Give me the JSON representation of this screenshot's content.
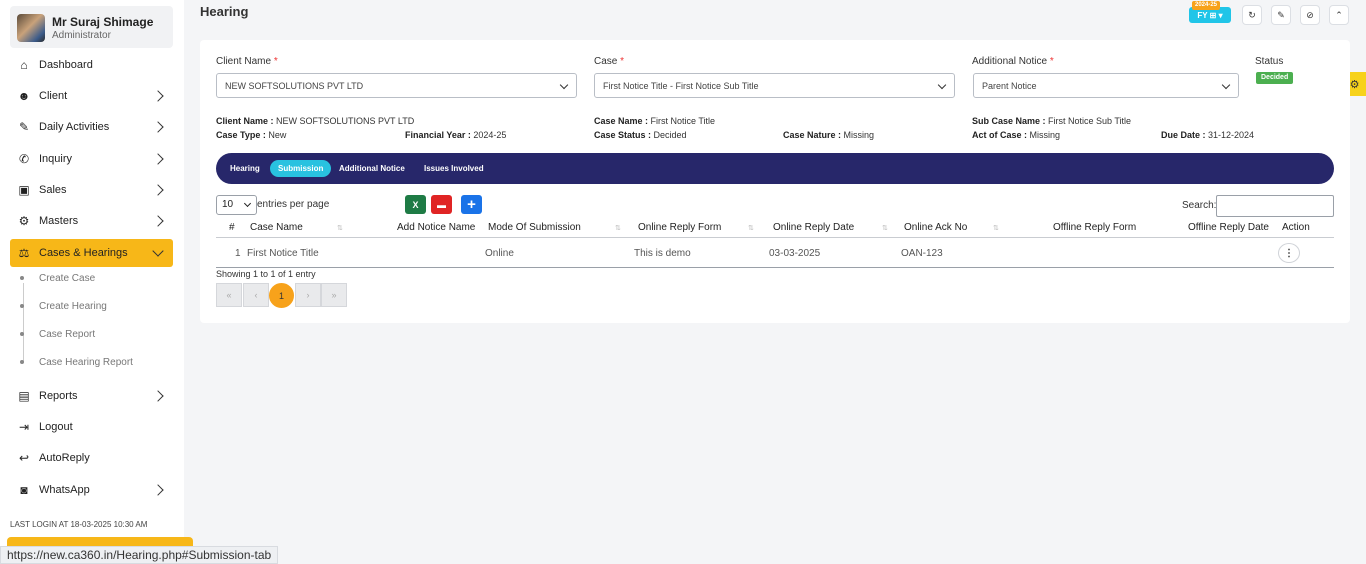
{
  "user": {
    "name": "Mr Suraj Shimage",
    "role": "Administrator"
  },
  "nav": {
    "dashboard": "Dashboard",
    "client": "Client",
    "daily": "Daily Activities",
    "inquiry": "Inquiry",
    "sales": "Sales",
    "masters": "Masters",
    "cases": "Cases & Hearings",
    "reports": "Reports",
    "logout": "Logout",
    "autoreply": "AutoReply",
    "whatsapp": "WhatsApp"
  },
  "subnav": {
    "create_case": "Create Case",
    "create_hearing": "Create Hearing",
    "case_report": "Case Report",
    "case_hearing_report": "Case Hearing Report"
  },
  "last_login": "LAST LOGIN AT 18-03-2025 10:30 AM",
  "status_url": "https://new.ca360.in/Hearing.php#Submission-tab",
  "page_title": "Hearing",
  "fy": {
    "tag": "2024-25",
    "label": "FY ⊞ ▾"
  },
  "form": {
    "client_label": "Client Name",
    "client_value": "NEW SOFTSOLUTIONS PVT LTD",
    "case_label": "Case",
    "case_value": "First Notice Title - First Notice Sub Title",
    "notice_label": "Additional Notice",
    "notice_value": "Parent Notice",
    "status_label": "Status",
    "status_value": "Decided",
    "required_mark": "*"
  },
  "info": {
    "client_name_k": "Client Name :",
    "client_name_v": " NEW SOFTSOLUTIONS PVT LTD",
    "case_name_k": "Case Name :",
    "case_name_v": " First Notice Title",
    "sub_case_k": "Sub Case Name :",
    "sub_case_v": " First Notice Sub Title",
    "case_type_k": "Case Type :",
    "case_type_v": " New",
    "fin_year_k": "Financial Year :",
    "fin_year_v": " 2024-25",
    "case_status_k": "Case Status :",
    "case_status_v": " Decided",
    "case_nature_k": "Case Nature :",
    "case_nature_v": " Missing",
    "act_k": "Act of Case :",
    "act_v": " Missing",
    "due_k": "Due Date :",
    "due_v": " 31-12-2024"
  },
  "tabs": [
    "Hearing",
    "Submission",
    "Additional Notice",
    "Issues Involved"
  ],
  "table_controls": {
    "entries_value": "10",
    "entries_text": "entries per page",
    "search_label": "Search:"
  },
  "table": {
    "headers": [
      "#",
      "Case Name",
      "Add Notice Name",
      "Mode Of Submission",
      "Online Reply Form",
      "Online Reply Date",
      "Online Ack No",
      "Offline Reply Form",
      "Offline Reply Date",
      "Action"
    ],
    "row": {
      "num": "1",
      "case_name": "First Notice Title",
      "add_notice": "",
      "mode": "Online",
      "online_form": "This is demo",
      "online_date": "03-03-2025",
      "ack": "OAN-123",
      "offline_form": "",
      "offline_date": ""
    }
  },
  "showing": "Showing 1 to 1 of 1 entry",
  "pagination": {
    "first": "«",
    "prev": "‹",
    "current": "1",
    "next": "›",
    "last": "»"
  },
  "colors": {
    "accent": "#f7b718",
    "tabbar": "#27276a",
    "active_tab": "#29c2e0",
    "status": "#4caf50"
  }
}
